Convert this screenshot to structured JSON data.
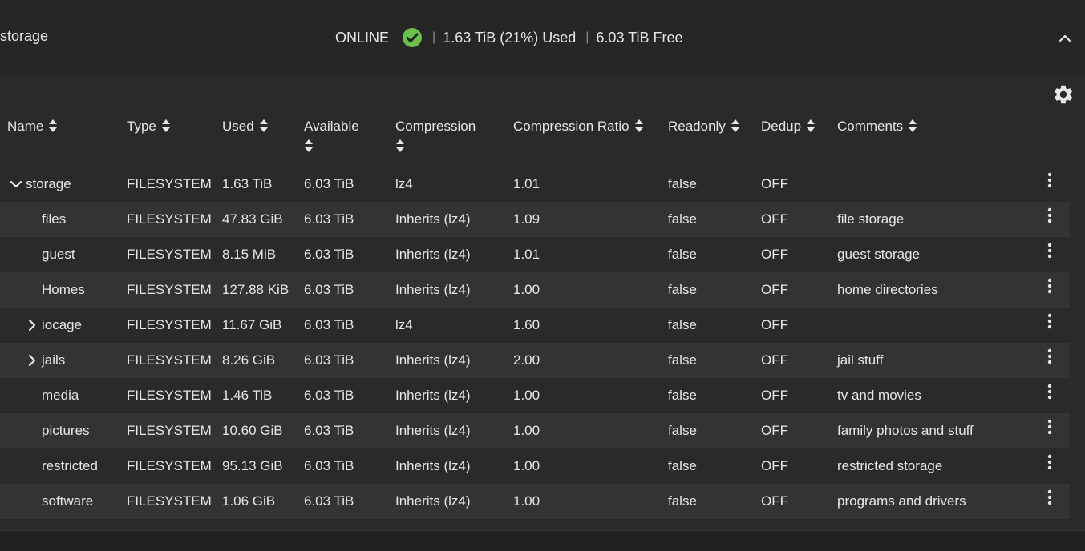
{
  "pool": {
    "name": "storage",
    "status": "ONLINE",
    "used": "1.63 TiB (21%) Used",
    "free": "6.03 TiB Free",
    "separator": "|",
    "status_color": "#6cc04a"
  },
  "columns": [
    {
      "key": "name",
      "label": "Name"
    },
    {
      "key": "type",
      "label": "Type"
    },
    {
      "key": "used",
      "label": "Used"
    },
    {
      "key": "available",
      "label": "Available"
    },
    {
      "key": "compression",
      "label": "Compression"
    },
    {
      "key": "ratio",
      "label": "Compression Ratio"
    },
    {
      "key": "readonly",
      "label": "Readonly"
    },
    {
      "key": "dedup",
      "label": "Dedup"
    },
    {
      "key": "comments",
      "label": "Comments"
    }
  ],
  "rows": [
    {
      "name": "storage",
      "type": "FILESYSTEM",
      "used": "1.63 TiB",
      "available": "6.03 TiB",
      "compression": "lz4",
      "ratio": "1.01",
      "readonly": "false",
      "dedup": "OFF",
      "comments": "",
      "expander": "chevron-down-icon"
    },
    {
      "name": "files",
      "type": "FILESYSTEM",
      "used": "47.83 GiB",
      "available": "6.03 TiB",
      "compression": "Inherits (lz4)",
      "ratio": "1.09",
      "readonly": "false",
      "dedup": "OFF",
      "comments": "file storage",
      "expander": ""
    },
    {
      "name": "guest",
      "type": "FILESYSTEM",
      "used": "8.15 MiB",
      "available": "6.03 TiB",
      "compression": "Inherits (lz4)",
      "ratio": "1.01",
      "readonly": "false",
      "dedup": "OFF",
      "comments": "guest storage",
      "expander": ""
    },
    {
      "name": "Homes",
      "type": "FILESYSTEM",
      "used": "127.88 KiB",
      "available": "6.03 TiB",
      "compression": "Inherits (lz4)",
      "ratio": "1.00",
      "readonly": "false",
      "dedup": "OFF",
      "comments": "home directories",
      "expander": ""
    },
    {
      "name": "iocage",
      "type": "FILESYSTEM",
      "used": "11.67 GiB",
      "available": "6.03 TiB",
      "compression": "lz4",
      "ratio": "1.60",
      "readonly": "false",
      "dedup": "OFF",
      "comments": "",
      "expander": "chevron-right-icon"
    },
    {
      "name": "jails",
      "type": "FILESYSTEM",
      "used": "8.26 GiB",
      "available": "6.03 TiB",
      "compression": "Inherits (lz4)",
      "ratio": "2.00",
      "readonly": "false",
      "dedup": "OFF",
      "comments": "jail stuff",
      "expander": "chevron-right-icon"
    },
    {
      "name": "media",
      "type": "FILESYSTEM",
      "used": "1.46 TiB",
      "available": "6.03 TiB",
      "compression": "Inherits (lz4)",
      "ratio": "1.00",
      "readonly": "false",
      "dedup": "OFF",
      "comments": "tv and movies",
      "expander": ""
    },
    {
      "name": "pictures",
      "type": "FILESYSTEM",
      "used": "10.60 GiB",
      "available": "6.03 TiB",
      "compression": "Inherits (lz4)",
      "ratio": "1.00",
      "readonly": "false",
      "dedup": "OFF",
      "comments": "family photos and stuff",
      "expander": ""
    },
    {
      "name": "restricted",
      "type": "FILESYSTEM",
      "used": "95.13 GiB",
      "available": "6.03 TiB",
      "compression": "Inherits (lz4)",
      "ratio": "1.00",
      "readonly": "false",
      "dedup": "OFF",
      "comments": "restricted storage",
      "expander": ""
    },
    {
      "name": "software",
      "type": "FILESYSTEM",
      "used": "1.06 GiB",
      "available": "6.03 TiB",
      "compression": "Inherits (lz4)",
      "ratio": "1.00",
      "readonly": "false",
      "dedup": "OFF",
      "comments": "programs and drivers",
      "expander": ""
    }
  ]
}
